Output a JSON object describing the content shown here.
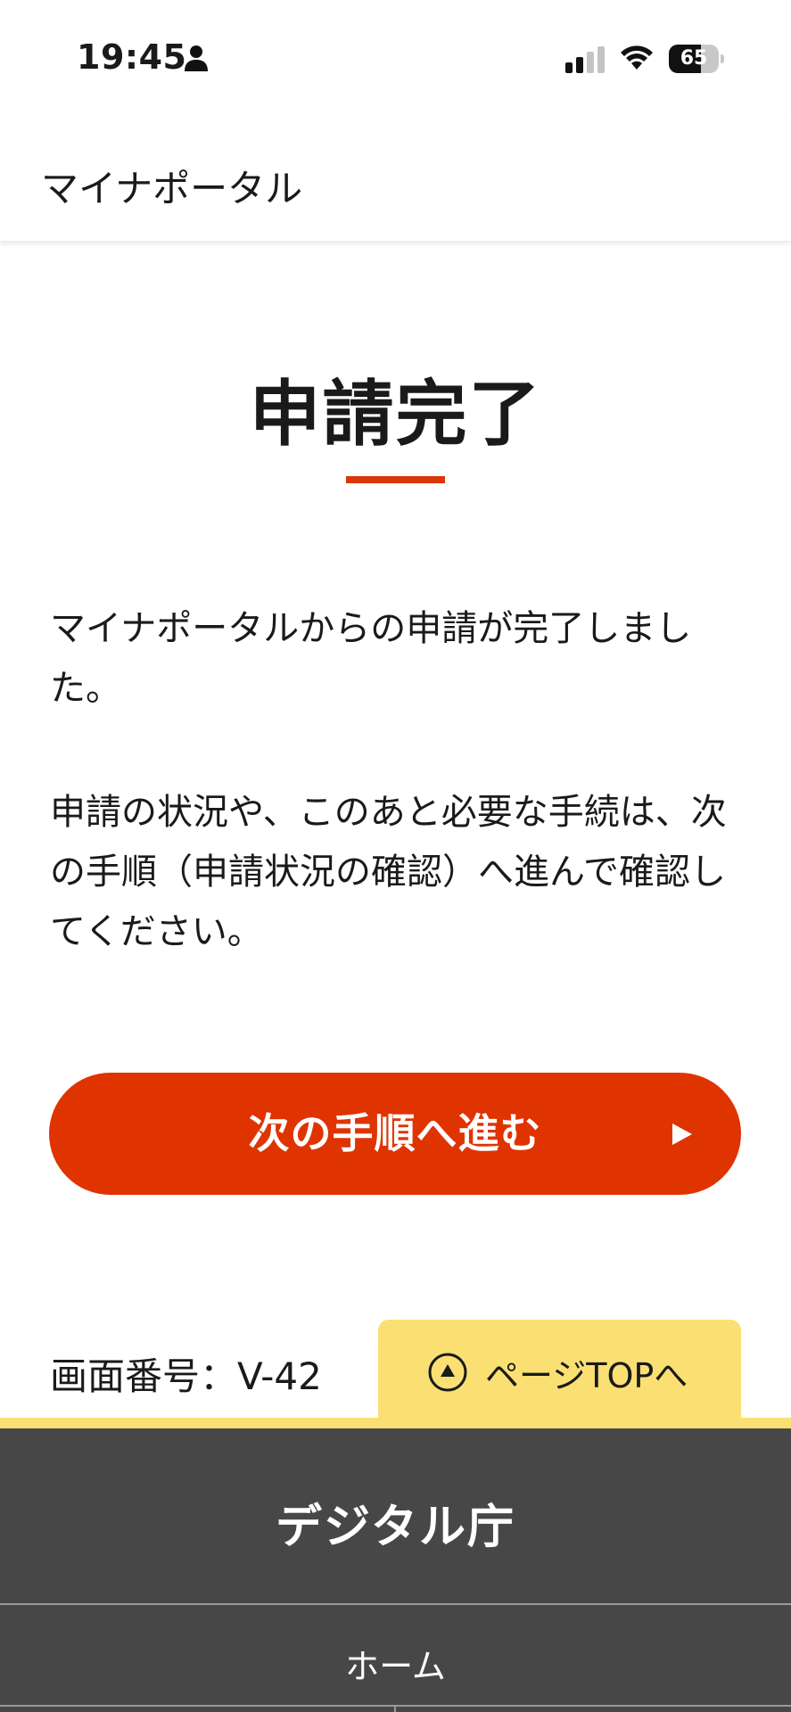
{
  "status_bar": {
    "time": "19:45",
    "battery_level": "65",
    "battery_fraction": 0.65,
    "icons": [
      "person-icon",
      "cellular-signal-icon",
      "wifi-icon",
      "battery-icon"
    ]
  },
  "header": {
    "title": "マイナポータル"
  },
  "main": {
    "title": "申請完了",
    "paragraph_1": "マイナポータルからの申請が完了しました。",
    "paragraph_2": "申請の状況や、このあと必要な手続は、次の手順（申請状況の確認）へ進んで確認してください。",
    "next_button_label": "次の手順へ進む",
    "next_button_icon": "play-arrow-icon"
  },
  "screen_number": "画面番号：V-42",
  "page_top": {
    "label": "ページTOPへ",
    "icon": "circle-up-arrow-icon"
  },
  "footer": {
    "brand": "デジタル庁",
    "home_link": "ホーム"
  },
  "colors": {
    "accent": "#e03400",
    "underline": "#d9380b",
    "page_top_bg": "#fae073",
    "footer_bg": "#474747"
  }
}
